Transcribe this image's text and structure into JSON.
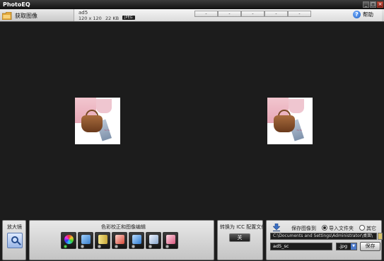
{
  "window": {
    "title": "PhotoEQ",
    "minimize": "_",
    "maximize": "□",
    "close": "×"
  },
  "toolbar": {
    "get_image": "获取图像",
    "file": {
      "name": "ad5",
      "dimensions": "120 x 120",
      "size": "22 KB",
      "format": "JPEG"
    },
    "zoom_buttons": [
      "-",
      "-",
      "-",
      "-",
      "-"
    ],
    "help": "帮助"
  },
  "magnifier": {
    "title": "放大镜"
  },
  "color_panel": {
    "title": "色彩校正和图像编辑",
    "tools": [
      {
        "name": "color-wheel",
        "icon_color": "#e8a13a",
        "enabled": true
      },
      {
        "name": "brush",
        "icon_color": "#5fa8e6",
        "enabled": false
      },
      {
        "name": "levels",
        "icon_color": "#d9d05a",
        "enabled": false
      },
      {
        "name": "crop",
        "icon_color": "#d44a3a",
        "enabled": false
      },
      {
        "name": "resize",
        "icon_color": "#4c9be0",
        "enabled": false
      },
      {
        "name": "frame",
        "icon_color": "#9fb9d6",
        "enabled": false
      },
      {
        "name": "eraser",
        "icon_color": "#e37a9a",
        "enabled": false
      }
    ]
  },
  "icc": {
    "title": "转换为 ICC 配置文件",
    "toggle_label": "关"
  },
  "save_panel": {
    "title": "保存图像到",
    "option_import": "导入文件夹",
    "option_other": "其它",
    "path": "C:\\Documents and Settings\\Administrator\\桌面\\",
    "filename": "ad5_sc",
    "format": ".jpg",
    "save_button": "保存"
  },
  "colors": {
    "background": "#1c1c1c",
    "panel": "#d6d6d6",
    "accent_blue": "#4b78c8"
  }
}
